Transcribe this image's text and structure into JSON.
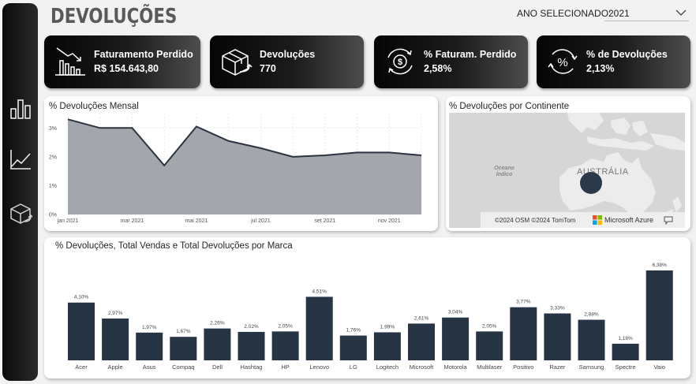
{
  "header": {
    "title": "DEVOLUÇÕES",
    "year_label": "ANO SELECIONADO:",
    "year_value": "2021"
  },
  "sidebar": {
    "items": [
      {
        "name": "bar-chart-icon"
      },
      {
        "name": "line-chart-icon"
      },
      {
        "name": "return-box-icon"
      }
    ]
  },
  "kpis": [
    {
      "title": "Faturamento Perdido",
      "value": "R$ 154.643,80",
      "icon": "falling-chart-icon"
    },
    {
      "title": "Devoluções",
      "value": "770",
      "icon": "box-return-icon"
    },
    {
      "title": "% Faturam. Perdido",
      "value": "2,58%",
      "icon": "money-cycle-icon"
    },
    {
      "title": "% de Devoluções",
      "value": "2,13%",
      "icon": "percent-cycle-icon"
    }
  ],
  "monthly": {
    "title": "% Devoluções Mensal",
    "y_ticks": [
      "0%",
      "1%",
      "2%",
      "3%"
    ],
    "x_ticks": [
      "jan 2021",
      "mar 2021",
      "mai 2021",
      "jul 2021",
      "set 2021",
      "nov 2021"
    ]
  },
  "continent": {
    "title": "% Devoluções por Continente",
    "ocean_label": "Oceano Índico",
    "country_label": "AUSTRÁLIA",
    "attribution": "©2024 OSM  ©2024 TomTom",
    "provider": "Microsoft Azure"
  },
  "brands": {
    "title": "% Devoluções, Total Vendas e Total Devoluções por Marca"
  },
  "colors": {
    "area_fill": "#a3a6ab",
    "area_line": "#2b3440",
    "bar": "#263444"
  },
  "chart_data": [
    {
      "type": "area",
      "title": "% Devoluções Mensal",
      "x": [
        "jan 2021",
        "fev 2021",
        "mar 2021",
        "abr 2021",
        "mai 2021",
        "jun 2021",
        "jul 2021",
        "ago 2021",
        "set 2021",
        "out 2021",
        "nov 2021",
        "dez 2021"
      ],
      "values": [
        3.3,
        3.0,
        3.0,
        1.7,
        3.05,
        2.55,
        2.3,
        2.0,
        2.05,
        2.15,
        2.15,
        2.05
      ],
      "ylim": [
        0,
        3.5
      ],
      "y_ticks": [
        "0%",
        "1%",
        "2%",
        "3%"
      ],
      "x_ticks": [
        "jan 2021",
        "mar 2021",
        "mai 2021",
        "jul 2021",
        "set 2021",
        "nov 2021"
      ],
      "grid": true
    },
    {
      "type": "bar",
      "title": "% Devoluções, Total Vendas e Total Devoluções por Marca",
      "categories": [
        "Acer",
        "Apple",
        "Asus",
        "Compaq",
        "Dell",
        "Hashtag",
        "HP",
        "Lenovo",
        "LG",
        "Logitech",
        "Microsoft",
        "Motorola",
        "Multilaser",
        "Positivo",
        "Razer",
        "Samsung",
        "Spectre",
        "Vaio"
      ],
      "values": [
        4.1,
        2.97,
        1.97,
        1.67,
        2.26,
        2.02,
        2.05,
        4.51,
        1.76,
        1.99,
        2.61,
        3.04,
        2.05,
        3.77,
        3.33,
        2.88,
        1.18,
        6.38
      ],
      "labels": [
        "4,10%",
        "2,97%",
        "1,97%",
        "1,67%",
        "2,26%",
        "2,02%",
        "2,05%",
        "4,51%",
        "1,76%",
        "1,99%",
        "2,61%",
        "3,04%",
        "2,05%",
        "3,77%",
        "3,33%",
        "2,88%",
        "1,18%",
        "6,38%"
      ]
    }
  ]
}
